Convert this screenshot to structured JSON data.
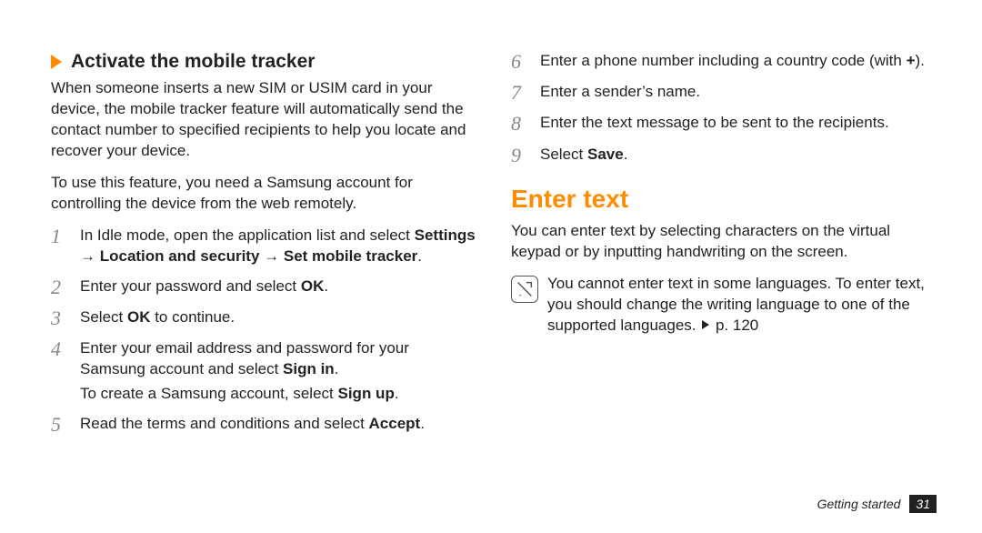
{
  "left": {
    "heading": "Activate the mobile tracker",
    "para1": "When someone inserts a new SIM or USIM card in your device, the mobile tracker feature will automatically send the contact number to specified recipients to help you locate and recover your device.",
    "para2": "To use this feature, you need a Samsung account for controlling the device from the web remotely.",
    "steps": [
      {
        "n": "1",
        "html": "In Idle mode, open the application list and select <span class='bi'>Settings → Location and security → Set mobile tracker</span>."
      },
      {
        "n": "2",
        "html": "Enter your password and select <b>OK</b>."
      },
      {
        "n": "3",
        "html": "Select <b>OK</b> to continue."
      },
      {
        "n": "4",
        "html": "Enter your email address and password for your Samsung account and select <b>Sign in</b>.<span class='sub'>To create a Samsung account, select <b>Sign up</b>.</span>"
      },
      {
        "n": "5",
        "html": "Read the terms and conditions and select <b>Accept</b>."
      }
    ]
  },
  "right": {
    "steps": [
      {
        "n": "6",
        "html": "Enter a phone number including a country code (with <b>+</b>)."
      },
      {
        "n": "7",
        "html": "Enter a sender’s name."
      },
      {
        "n": "8",
        "html": "Enter the text message to be sent to the recipients."
      },
      {
        "n": "9",
        "html": "Select <b>Save</b>."
      }
    ],
    "mainheading": "Enter text",
    "para1": "You can enter text by selecting characters on the virtual keypad or by inputting handwriting on the screen.",
    "note": "You cannot enter text in some languages. To enter text, you should change the writing language to one of the supported languages. <span class='tri'></span> p. 120"
  },
  "footer": {
    "section": "Getting started",
    "page": "31"
  }
}
